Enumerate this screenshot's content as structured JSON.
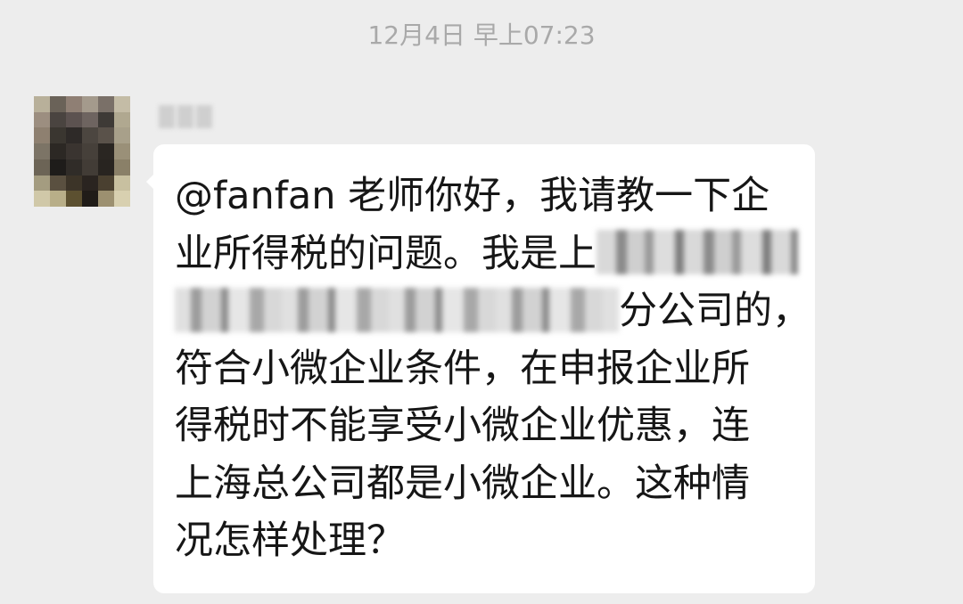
{
  "chat": {
    "timestamp": "12月4日 早上07:23",
    "message": {
      "lines": [
        {
          "text": "@fanfan 老师你好，我请教一下企"
        },
        {
          "text": "业所得税的问题。我是上"
        },
        {
          "text": "分公司的，"
        },
        {
          "text": "符合小微企业条件，在申报企业所"
        },
        {
          "text": "得税时不能享受小微企业优惠，连"
        },
        {
          "text": "上海总公司都是小微企业。这种情"
        },
        {
          "text": "况怎样处理？"
        }
      ]
    }
  },
  "colors": {
    "background": "#ededed",
    "bubble": "#ffffff",
    "timestamp": "#a9a9a9",
    "text": "#161616"
  },
  "icons": {
    "avatar": "user-avatar-pixelated"
  }
}
